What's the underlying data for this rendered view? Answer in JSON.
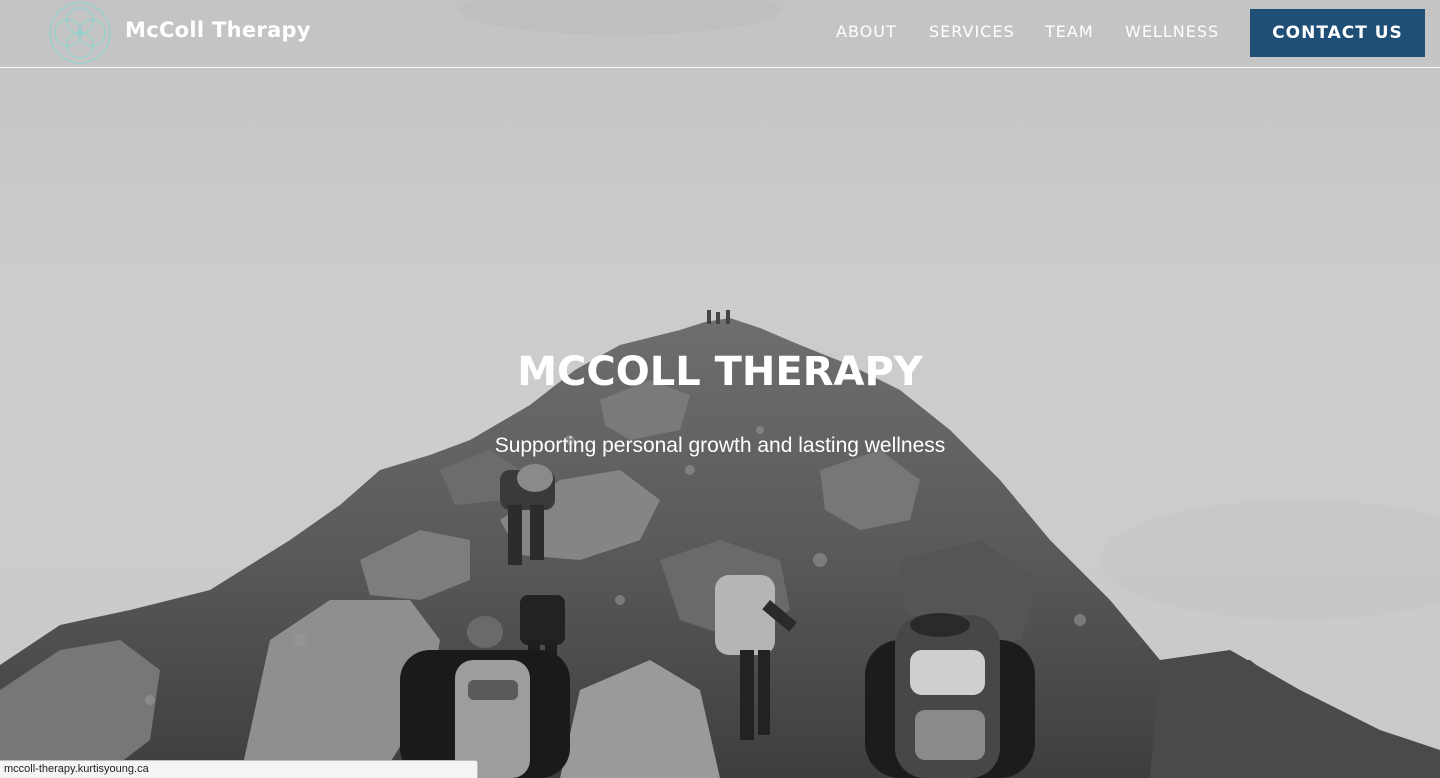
{
  "header": {
    "brand_name": "McColl Therapy",
    "logo_icon": "overlapping-circles-logo-icon",
    "nav": {
      "about": "ABOUT",
      "services": "SERVICES",
      "team": "TEAM",
      "wellness": "WELLNESS"
    },
    "contact_label": "CONTACT US"
  },
  "hero": {
    "title": "MCCOLL THERAPY",
    "subtitle": "Supporting personal growth and lasting wellness",
    "background": "mountain-hikers-photo"
  },
  "status_bar": {
    "url": "mccoll-therapy.kurtisyoung.ca"
  },
  "colors": {
    "accent": "#1f4f77",
    "logo": "#8fd3cf",
    "text": "#ffffff"
  }
}
